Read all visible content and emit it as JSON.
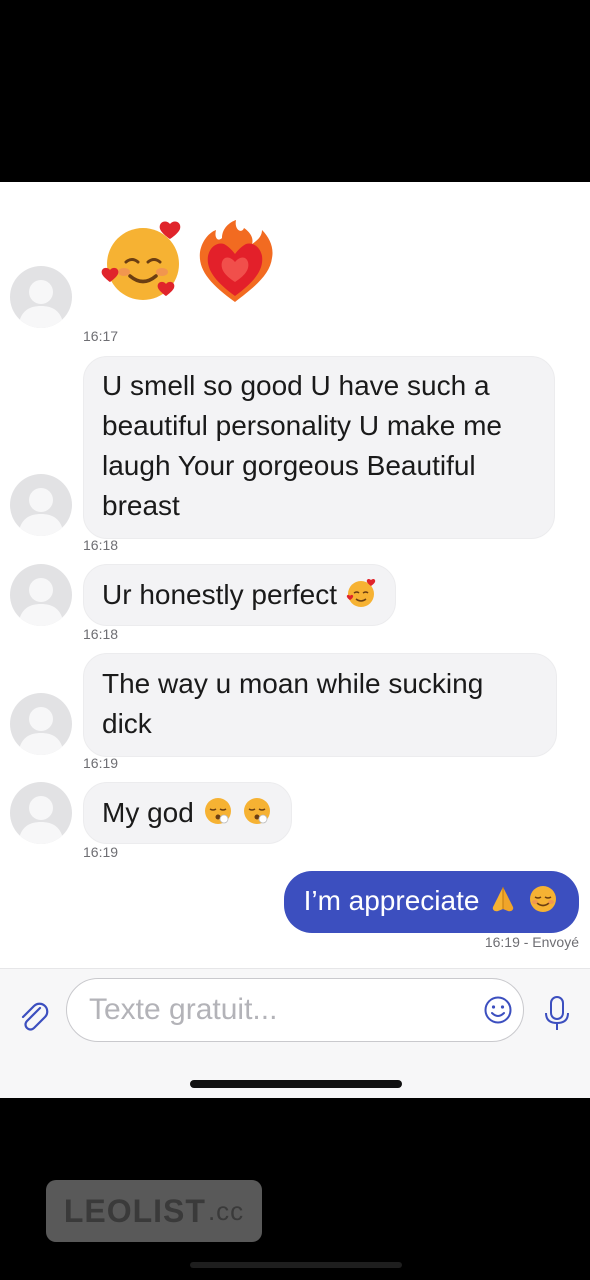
{
  "messages": [
    {
      "id": "m1",
      "type": "emoji",
      "emojis": [
        "smiling-face-with-hearts",
        "heart-on-fire"
      ],
      "time": "16:17"
    },
    {
      "id": "m2",
      "type": "text",
      "text": "U smell so good U have such a beautiful personality U make me laugh Your gorgeous Beautiful breast",
      "time": "16:18"
    },
    {
      "id": "m3",
      "type": "text",
      "text": "Ur honestly perfect",
      "emoji": "smiling-face-with-hearts",
      "time": "16:18"
    },
    {
      "id": "m4",
      "type": "text",
      "text": "The way u moan while sucking dick",
      "time": "16:19"
    },
    {
      "id": "m5",
      "type": "text",
      "text": "My god",
      "emojis": [
        "face-exhaling",
        "face-exhaling"
      ],
      "time": "16:19"
    },
    {
      "id": "m6",
      "type": "sent",
      "text": "I’m appreciate",
      "emojis": [
        "folded-hands",
        "smiling-face"
      ],
      "status": "16:19 - Envoyé"
    }
  ],
  "composer": {
    "placeholder": "Texte gratuit..."
  },
  "watermark": {
    "brand": "LEOLIST",
    "suffix": ".cc"
  },
  "colors": {
    "sent_bubble": "#3c4fbf",
    "received_bubble": "#f3f3f5",
    "timestamp": "#6e6e73"
  }
}
